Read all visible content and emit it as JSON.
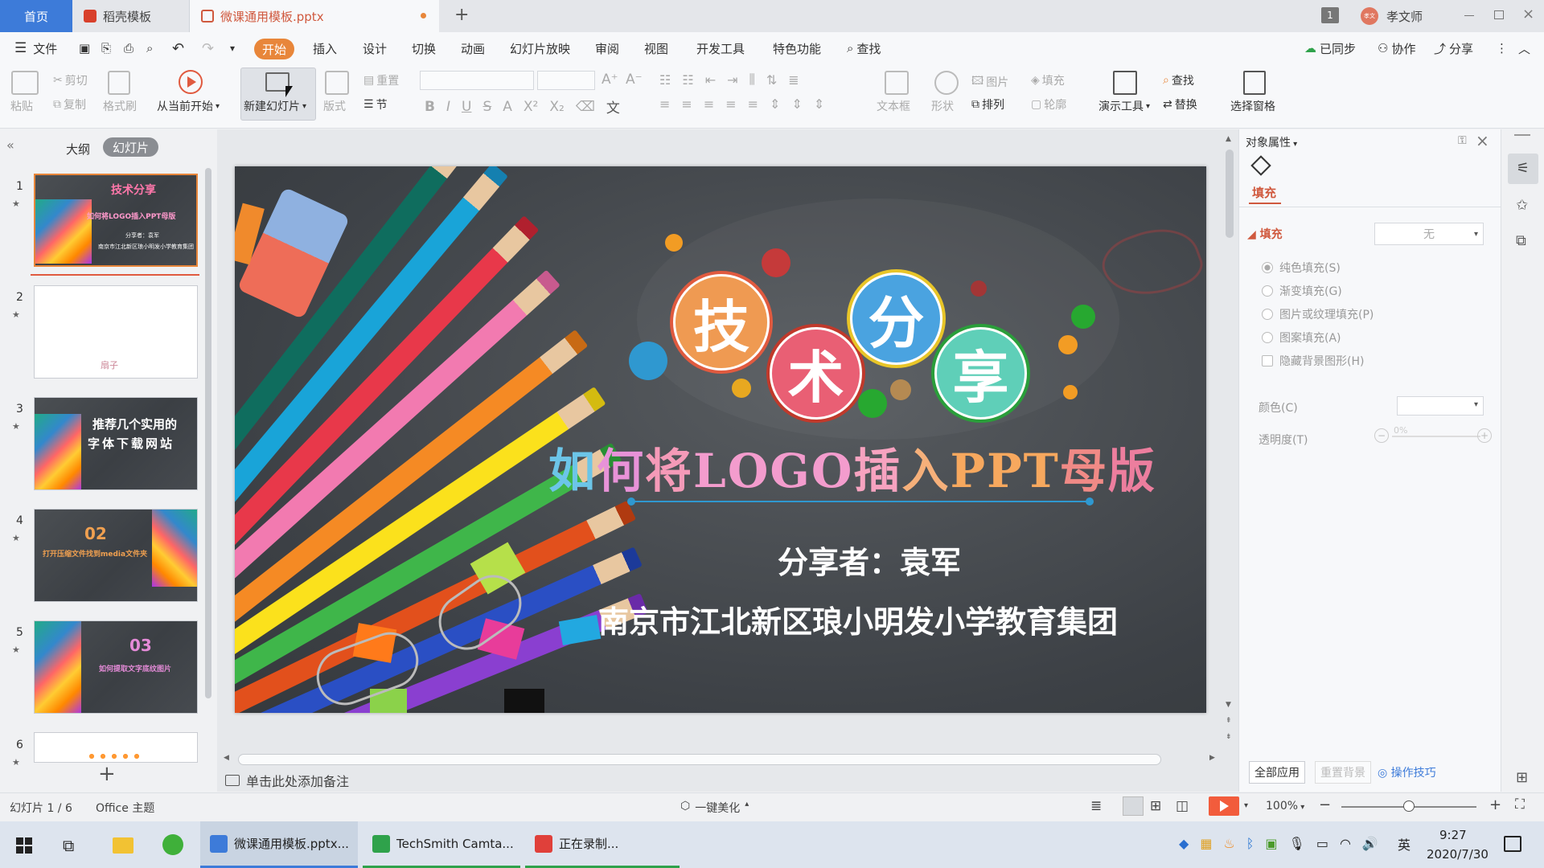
{
  "tabs": {
    "home": "首页",
    "template": "稻壳模板",
    "file": "微课通用模板.pptx"
  },
  "window": {
    "count": "1",
    "user": "孝文师",
    "avatar": "孝文"
  },
  "menu": {
    "file": "文件",
    "items": [
      "开始",
      "插入",
      "设计",
      "切换",
      "动画",
      "幻灯片放映",
      "审阅",
      "视图",
      "开发工具",
      "特色功能"
    ],
    "search": "查找",
    "synced": "已同步",
    "collab": "协作",
    "share": "分享"
  },
  "ribbon": {
    "paste": "粘贴",
    "cut": "剪切",
    "copy": "复制",
    "format_painter": "格式刷",
    "play_from_current": "从当前开始",
    "new_slide": "新建幻灯片",
    "layout": "版式",
    "reset": "重置",
    "section": "节",
    "textbox": "文本框",
    "shape": "形状",
    "picture": "图片",
    "fill": "填充",
    "arrange": "排列",
    "outline": "轮廓",
    "present_tools": "演示工具",
    "find": "查找",
    "replace": "替换",
    "select_pane": "选择窗格"
  },
  "left_pane": {
    "tab_outline": "大纲",
    "tab_slides": "幻灯片",
    "thumbs": [
      {
        "num": "1",
        "title": "技术分享",
        "sub": "如何将LOGO插入PPT母版",
        "line1": "分享者：袁军",
        "line2": "南京市江北新区琅小明发小学教育集团"
      },
      {
        "num": "2",
        "title": "",
        "text": "扇子"
      },
      {
        "num": "3",
        "title": "推荐几个实用的",
        "sub": "字体下载网站"
      },
      {
        "num": "4",
        "title": "02",
        "sub": "打开压缩文件找到media文件夹"
      },
      {
        "num": "5",
        "title": "03",
        "sub": "如何提取文字底纹图片"
      },
      {
        "num": "6",
        "title": ""
      }
    ]
  },
  "slide": {
    "chars": [
      "技",
      "术",
      "分",
      "享"
    ],
    "title_parts": [
      "如",
      "何",
      "将",
      "LOGO",
      "插",
      "入",
      "PPT",
      "母",
      "版"
    ],
    "sharer": "分享者：袁军",
    "org": "南京市江北新区琅小明发小学教育集团"
  },
  "notes": {
    "placeholder": "单击此处添加备注"
  },
  "right_pane": {
    "title": "对象属性",
    "tab_fill": "填充",
    "section_fill": "填充",
    "fill_value": "无",
    "options": [
      "纯色填充(S)",
      "渐变填充(G)",
      "图片或纹理填充(P)",
      "图案填充(A)"
    ],
    "hide_bg": "隐藏背景图形(H)",
    "color_label": "颜色(C)",
    "transparency_label": "透明度(T)",
    "transparency_value": "0%",
    "apply_all": "全部应用",
    "reset_bg": "重置背景",
    "tips": "操作技巧"
  },
  "status": {
    "slide_pos": "幻灯片 1 / 6",
    "theme": "Office 主题",
    "beautify": "一键美化",
    "zoom": "100%"
  },
  "taskbar": {
    "apps": [
      "微课通用模板.pptx...",
      "TechSmith Camta...",
      "正在录制..."
    ],
    "ime": "英",
    "time": "9:27",
    "date": "2020/7/30"
  },
  "colors": {
    "accent": "#e8863a",
    "home_tab": "#3d7bd9",
    "link": "#3d7bd9"
  }
}
